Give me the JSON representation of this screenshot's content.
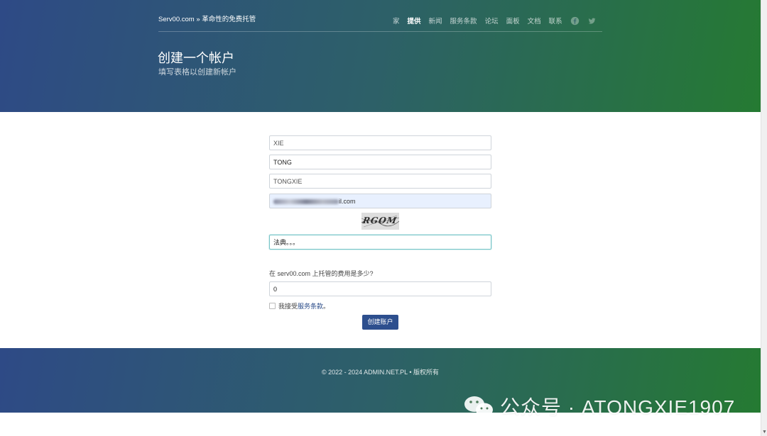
{
  "header": {
    "brand": "Serv00.com » 革命性的免费托管",
    "nav": [
      {
        "label": "家",
        "active": false
      },
      {
        "label": "提供",
        "active": true
      },
      {
        "label": "新闻",
        "active": false
      },
      {
        "label": "服务条款",
        "active": false
      },
      {
        "label": "论坛",
        "active": false
      },
      {
        "label": "面板",
        "active": false
      },
      {
        "label": "文档",
        "active": false
      },
      {
        "label": "联系",
        "active": false
      }
    ],
    "social_icons": [
      "facebook-icon",
      "twitter-icon"
    ],
    "title": "创建一个帐户",
    "subtitle": "填写表格以创建新帐户"
  },
  "form": {
    "first_name": "XIE",
    "last_name": "TONG",
    "username": "TONGXIE",
    "email_suffix": "il.com",
    "captcha_text": "RGOM",
    "captcha_input": "法典。。。",
    "question": "在 serv00.com 上托管的费用是多少?",
    "answer": "0",
    "accept_prefix": "我接受",
    "accept_link": "服务条款",
    "accept_suffix": "。",
    "submit_label": "创建账户"
  },
  "footer": {
    "copyright": "© 2022 - 2024 ADMIN.NET.PL • 版权所有"
  },
  "watermark": {
    "text": "公众号 · ATONGXIE1907"
  },
  "colors": {
    "gradient_start": "#2e4a86",
    "gradient_end": "#257a32",
    "button": "#2d4f8e",
    "autofill": "#e8f0fe"
  }
}
